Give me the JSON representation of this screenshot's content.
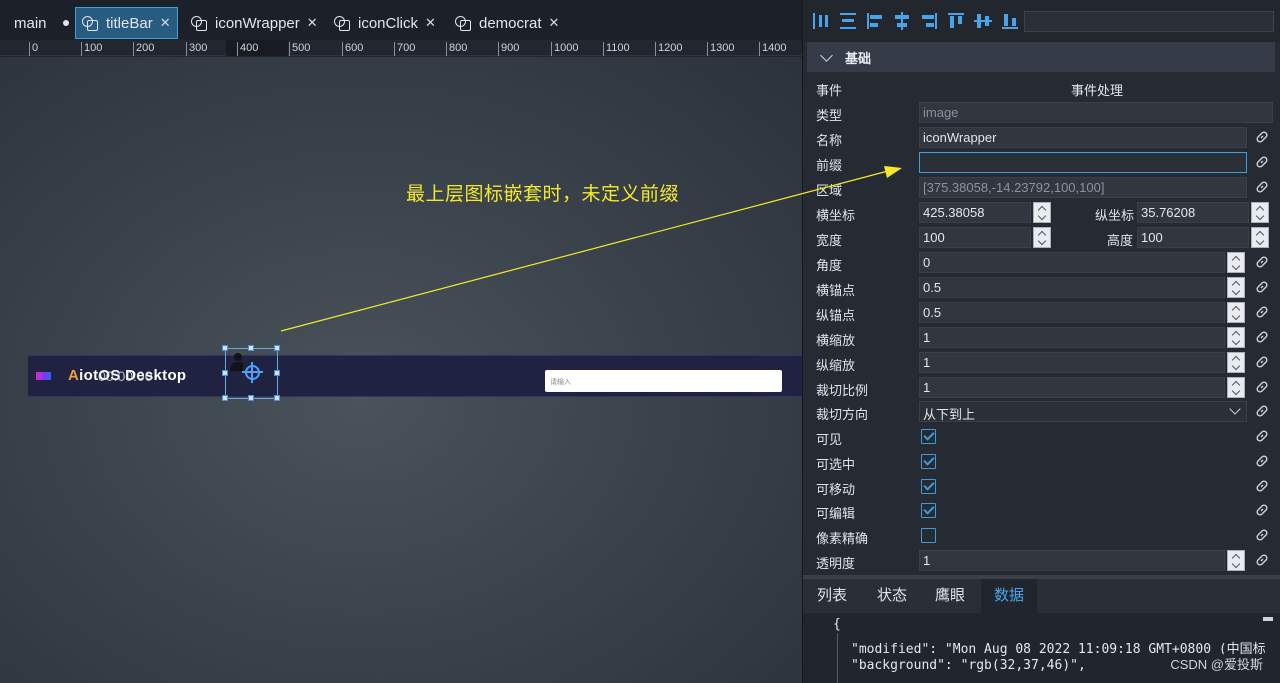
{
  "tabs": [
    {
      "label": "main",
      "modified": true
    },
    {
      "label": "titleBar",
      "active": true
    },
    {
      "label": "iconWrapper"
    },
    {
      "label": "iconClick"
    },
    {
      "label": "democrat"
    }
  ],
  "ruler": {
    "ticks": [
      "0",
      "100",
      "200",
      "300",
      "400",
      "500",
      "600",
      "700",
      "800",
      "900",
      "1000",
      "1100",
      "1200",
      "1300",
      "1400"
    ]
  },
  "canvas": {
    "brand_text_a": "A",
    "brand_text_rest": "iotOS Desktop",
    "time_overlay": "00:00:00",
    "search_placeholder": "请输入",
    "annotation": "最上层图标嵌套时，未定义前缀",
    "annotation_color": "#f4ea2a"
  },
  "properties": {
    "section": "基础",
    "event_label": "事件",
    "event_value": "事件处理",
    "type_label": "类型",
    "type_value": "image",
    "name_label": "名称",
    "name_value": "iconWrapper",
    "prefix_label": "前缀",
    "prefix_value": "",
    "region_label": "区域",
    "region_value": "[375.38058,-14.23792,100,100]",
    "x_label": "横坐标",
    "x_value": "425.38058",
    "y_label": "纵坐标",
    "y_value": "35.76208",
    "width_label": "宽度",
    "width_value": "100",
    "height_label": "高度",
    "height_value": "100",
    "angle_label": "角度",
    "angle_value": "0",
    "anchor_x_label": "横锚点",
    "anchor_x_value": "0.5",
    "anchor_y_label": "纵锚点",
    "anchor_y_value": "0.5",
    "scale_x_label": "横缩放",
    "scale_x_value": "1",
    "scale_y_label": "纵缩放",
    "scale_y_value": "1",
    "clip_ratio_label": "裁切比例",
    "clip_ratio_value": "1",
    "clip_dir_label": "裁切方向",
    "clip_dir_value": "从下到上",
    "visible_label": "可见",
    "visible": true,
    "selectable_label": "可选中",
    "selectable": true,
    "movable_label": "可移动",
    "movable": true,
    "editable_label": "可编辑",
    "editable": true,
    "pixel_label": "像素精确",
    "pixel": false,
    "opacity_label": "透明度",
    "opacity_value": "1"
  },
  "bottom_tabs": [
    "列表",
    "状态",
    "鹰眼",
    "数据"
  ],
  "bottom_active": "数据",
  "code": {
    "line0": "{",
    "line1": "\"modified\": \"Mon Aug 08 2022 11:09:18 GMT+0800 (中国标",
    "line2": "\"background\": \"rgb(32,37,46)\","
  },
  "watermark": "CSDN @爱投斯",
  "colors": {
    "accent": "#3e9ad8",
    "annotation": "#f4ea2a"
  }
}
